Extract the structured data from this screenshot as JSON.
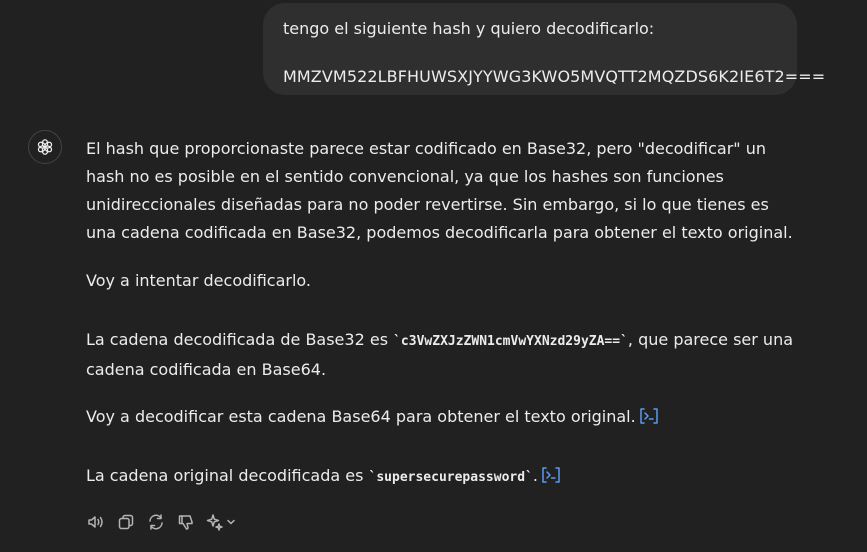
{
  "user_message": {
    "line1": "tengo el siguiente hash y quiero decodificarlo:",
    "line2": "MMZVM522LBFHUWSXJYYWG3KWO5MVQTT2MQZDS6K2IE6T2==="
  },
  "assistant": {
    "paragraph1": "El hash que proporcionaste parece estar codificado en Base32, pero \"decodificar\" un hash no es posible en el sentido convencional, ya que los hashes son funciones unidireccionales diseñadas para no poder revertirse. Sin embargo, si lo que tienes es una cadena codificada en Base32, podemos decodificarla para obtener el texto original.",
    "paragraph2": "Voy a intentar decodificarlo.",
    "paragraph3_before": "La cadena decodificada de Base32 es ",
    "paragraph3_code": "`c3VwZXJzZWN1cmVwYXNzd29yZA==`",
    "paragraph3_after": ", que parece ser una cadena codificada en Base64.",
    "paragraph4": "Voy a decodificar esta cadena Base64 para obtener el texto original.",
    "paragraph5_before": "La cadena original decodificada es ",
    "paragraph5_code": "`supersecurepassword`",
    "paragraph5_after": "."
  },
  "icons": {
    "avatar": "openai-logo-icon",
    "code_link": "code-interpreter-icon",
    "actions": [
      "read-aloud-icon",
      "copy-icon",
      "regenerate-icon",
      "thumbs-down-icon",
      "sparkle-icon",
      "chevron-down-icon"
    ]
  },
  "colors": {
    "background": "#212121",
    "bubble": "#2f2f2f",
    "text": "#ececec",
    "icon": "#b4b4b4",
    "link_blue": "#5b9bf0"
  }
}
